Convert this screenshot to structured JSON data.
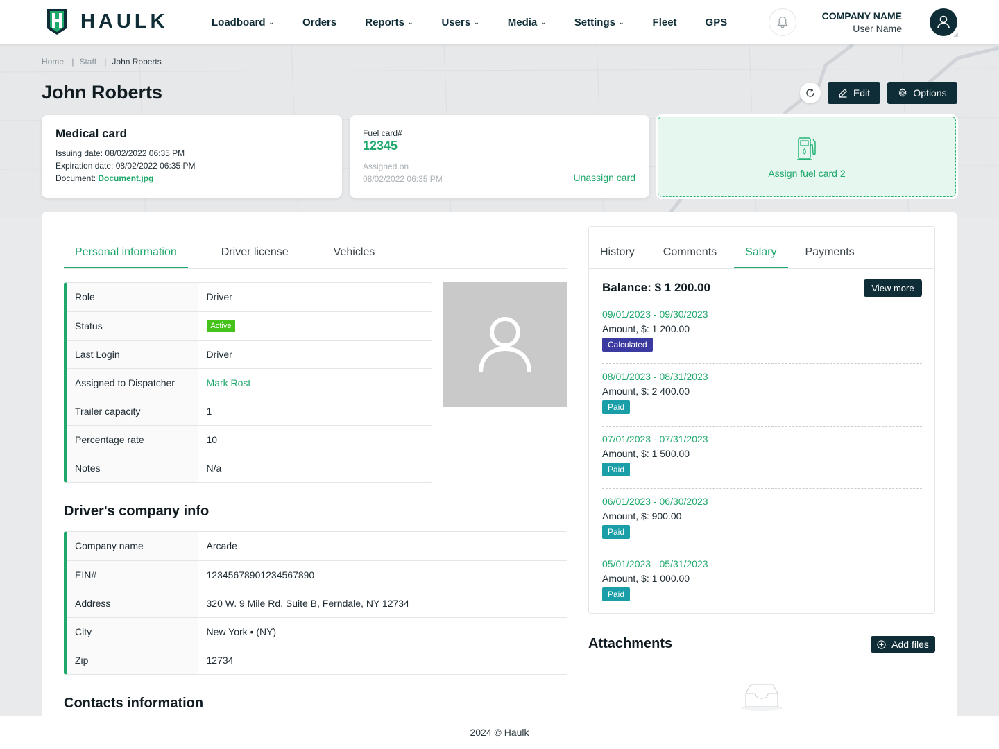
{
  "brand": {
    "name": "HAULK"
  },
  "nav": {
    "items": [
      {
        "label": "Loadboard",
        "dropdown": true
      },
      {
        "label": "Orders",
        "dropdown": false
      },
      {
        "label": "Reports",
        "dropdown": true
      },
      {
        "label": "Users",
        "dropdown": true
      },
      {
        "label": "Media",
        "dropdown": true
      },
      {
        "label": "Settings",
        "dropdown": true
      },
      {
        "label": "Fleet",
        "dropdown": false
      },
      {
        "label": "GPS",
        "dropdown": false
      }
    ]
  },
  "account": {
    "company_name": "COMPANY NAME",
    "user_name": "User Name"
  },
  "breadcrumb": [
    "Home",
    "Staff",
    "John Roberts"
  ],
  "page": {
    "title": "John Roberts",
    "edit_label": "Edit",
    "options_label": "Options"
  },
  "medical_card": {
    "title": "Medical card",
    "issuing_label": "Issuing date:",
    "issuing_value": "08/02/2022 06:35 PM",
    "expiration_label": "Expiration date:",
    "expiration_value": "08/02/2022 06:35 PM",
    "document_label": "Document:",
    "document_value": "Document.jpg"
  },
  "fuel_card": {
    "label": "Fuel card#",
    "number": "12345",
    "assigned_label": "Assigned on",
    "assigned_value": "08/02/2022 06:35 PM",
    "unassign_label": "Unassign card"
  },
  "assign_card": {
    "label": "Assign fuel card 2",
    "icon": "fuel-pump-icon"
  },
  "left_tabs": [
    "Personal information",
    "Driver license",
    "Vehicles"
  ],
  "personal_info": [
    {
      "key": "Role",
      "value": "Driver"
    },
    {
      "key": "Status",
      "value": "Active"
    },
    {
      "key": "Last Login",
      "value": "Driver"
    },
    {
      "key": "Assigned to Dispatcher",
      "value": "Mark Rost"
    },
    {
      "key": "Trailer capacity",
      "value": "1"
    },
    {
      "key": "Percentage rate",
      "value": "10"
    },
    {
      "key": "Notes",
      "value": "N/a"
    }
  ],
  "company_section": {
    "title": "Driver's company info"
  },
  "company_info": [
    {
      "key": "Company name",
      "value": "Arcade"
    },
    {
      "key": "EIN#",
      "value": "12345678901234567890"
    },
    {
      "key": "Address",
      "value": "320 W. 9 Mile Rd. Suite B, Ferndale, NY 12734"
    },
    {
      "key": "City",
      "value": "New York • (NY)"
    },
    {
      "key": "Zip",
      "value": "12734"
    }
  ],
  "contacts_section": {
    "title": "Contacts information"
  },
  "right_tabs": [
    "History",
    "Comments",
    "Salary",
    "Payments"
  ],
  "salary": {
    "balance": "Balance: $ 1 200.00",
    "view_more": "View more",
    "items": [
      {
        "period": "09/01/2023 - 09/30/2023",
        "amount": "Amount, $: 1 200.00",
        "status": "Calculated"
      },
      {
        "period": "08/01/2023 - 08/31/2023",
        "amount": "Amount, $: 2 400.00",
        "status": "Paid"
      },
      {
        "period": "07/01/2023 - 07/31/2023",
        "amount": "Amount, $: 1 500.00",
        "status": "Paid"
      },
      {
        "period": "06/01/2023 - 06/30/2023",
        "amount": "Amount, $: 900.00",
        "status": "Paid"
      },
      {
        "period": "05/01/2023 - 05/31/2023",
        "amount": "Amount, $: 1 000.00",
        "status": "Paid"
      }
    ]
  },
  "attachments": {
    "title": "Attachments",
    "add_label": "Add files"
  },
  "footer": {
    "text": "2024 © Haulk"
  },
  "colors": {
    "brand_dark": "#0f2d36",
    "accent_green": "#1fa86b",
    "calculated": "#3b3aa0",
    "paid": "#1a9ea8",
    "active": "#45c31a"
  }
}
